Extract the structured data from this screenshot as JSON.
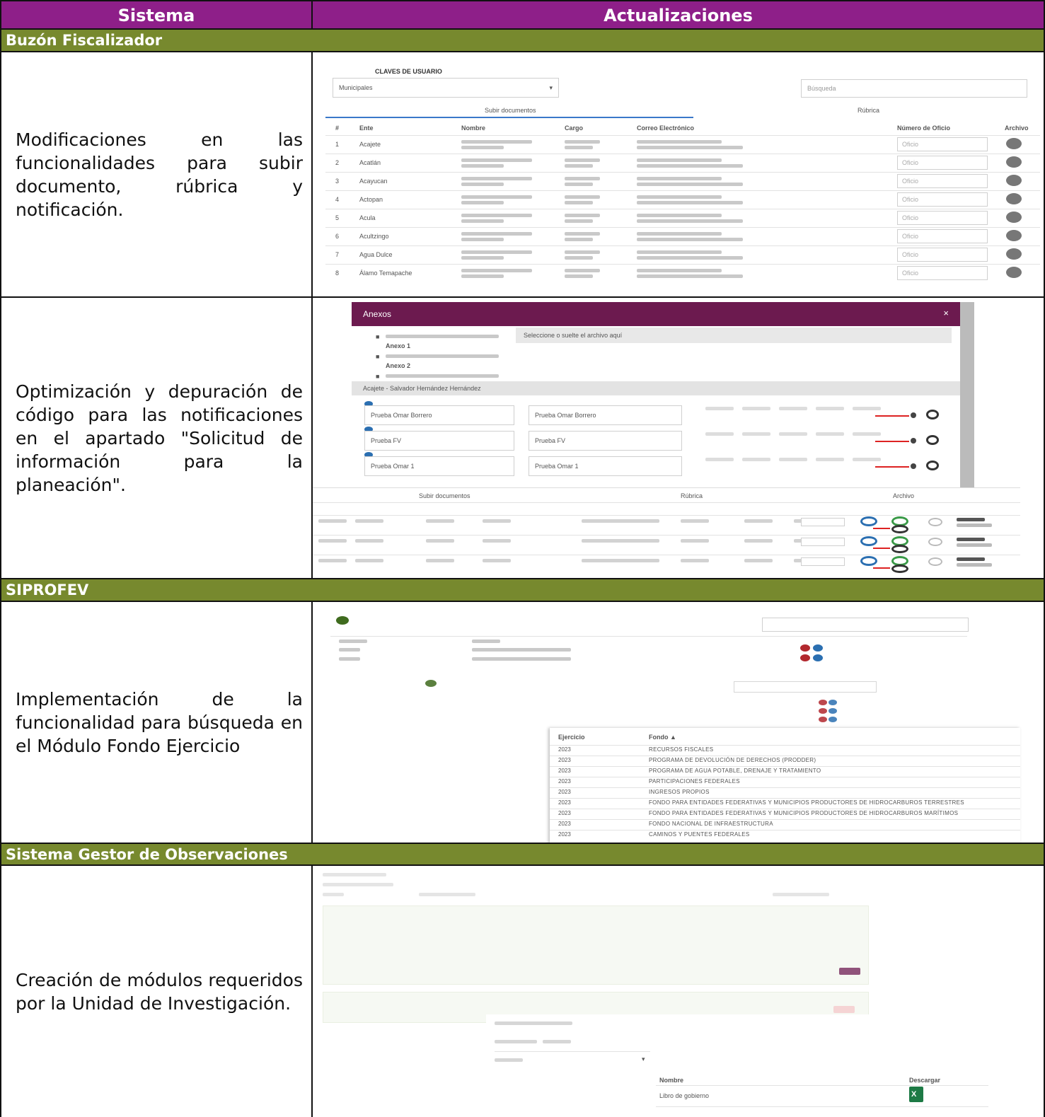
{
  "table": {
    "header": {
      "col_sistema": "Sistema",
      "col_actualizaciones": "Actualizaciones"
    },
    "sections": [
      {
        "title": "Buzón Fiscalizador",
        "rows": [
          {
            "description": "Modificaciones en las funcionalidades para subir documento, rúbrica y notificación.",
            "screenshot": {
              "title": "CLAVES DE USUARIO",
              "select_value": "Municipales",
              "search_placeholder": "Búsqueda",
              "tabs": [
                "Subir documentos",
                "Rúbrica"
              ],
              "columns": [
                "#",
                "Ente",
                "Nombre",
                "Cargo",
                "Correo Electrónico",
                "Número de Oficio",
                "Archivo"
              ],
              "row_names": [
                "Acajete",
                "Acatlán",
                "Acayucan",
                "Actopan",
                "Acula",
                "Acultzingo",
                "Agua Dulce",
                "Álamo Temapache"
              ],
              "row_field": "Oficio"
            }
          },
          {
            "description": "Optimización y depuración de código para las notificaciones en el apartado \"Solicitud de información para la planeación\".",
            "screenshot": {
              "modal_title": "Anexos",
              "close": "×",
              "files": [
                "Anexo 1",
                "Anexo 2"
              ],
              "dropzone": "Seleccione o suelte el archivo aquí",
              "group_label": "Acajete - Salvador Hernández Hernández",
              "entries": [
                "Prueba Omar Borrero",
                "Prueba FV",
                "Prueba Omar 1"
              ],
              "tabs": [
                "Subir documentos",
                "Rúbrica",
                "Archivo"
              ]
            }
          }
        ]
      },
      {
        "title": "SIPROFEV",
        "rows": [
          {
            "description": "Implementación de la funcionalidad para búsqueda en el Módulo Fondo Ejercicio",
            "screenshot": {
              "col_ejercicio": "Ejercicio",
              "col_fondo": "Fondo ▲",
              "years": [
                "2023",
                "2023",
                "2023",
                "2023",
                "2023",
                "2023",
                "2023",
                "2023",
                "2023"
              ],
              "funds": [
                "RECURSOS FISCALES",
                "PROGRAMA DE DEVOLUCIÓN DE DERECHOS (PRODDER)",
                "PROGRAMA DE AGUA POTABLE, DRENAJE Y TRATAMIENTO",
                "PARTICIPACIONES FEDERALES",
                "INGRESOS PROPIOS",
                "FONDO PARA ENTIDADES FEDERATIVAS Y MUNICIPIOS PRODUCTORES DE HIDROCARBUROS TERRESTRES",
                "FONDO PARA ENTIDADES FEDERATIVAS Y MUNICIPIOS PRODUCTORES DE HIDROCARBUROS MARÍTIMOS",
                "FONDO NACIONAL DE INFRAESTRUCTURA",
                "CAMINOS Y PUENTES FEDERALES"
              ]
            }
          }
        ]
      },
      {
        "title": "Sistema Gestor de Observaciones",
        "rows": [
          {
            "description": "Creación de módulos requeridos por la Unidad de Investigación.",
            "screenshot": {
              "col_nombre": "Nombre",
              "col_descargar": "Descargar",
              "row_nombre": "Libro de gobierno"
            }
          }
        ]
      }
    ]
  },
  "colors": {
    "header": "#8e1f89",
    "section": "#77892e",
    "modal": "#6c1a4f",
    "excel": "#1d7a45"
  }
}
